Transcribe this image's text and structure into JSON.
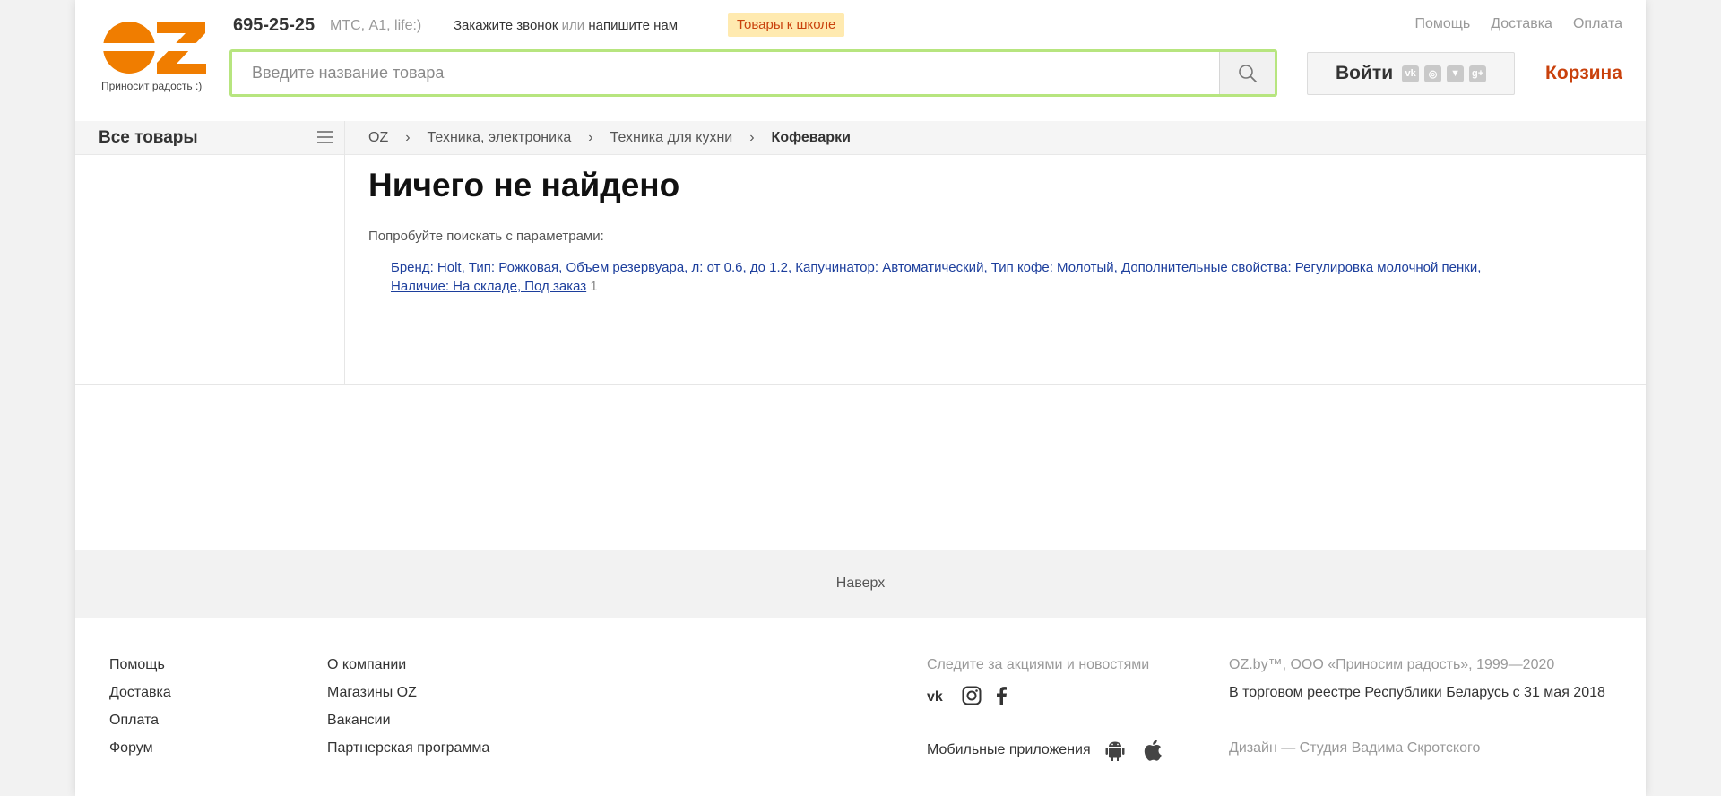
{
  "header": {
    "logo_text": "OZ",
    "logo_slogan": "Приносит радость :)",
    "phone": "695-25-25",
    "operators": "МТС, A1, life:)",
    "callback_order": "Закажите звонок",
    "callback_or": "или",
    "callback_write": "напишите нам",
    "school_badge": "Товары к школе",
    "top_links": [
      "Помощь",
      "Доставка",
      "Оплата"
    ],
    "search_placeholder": "Введите название товара",
    "login_label": "Войти",
    "cart_label": "Корзина"
  },
  "catalog": {
    "all_goods": "Все товары",
    "breadcrumb": [
      "OZ",
      "Техника, электроника",
      "Техника для кухни",
      "Кофеварки"
    ]
  },
  "main": {
    "title": "Ничего не найдено",
    "hint": "Попробуйте поискать с параметрами:",
    "suggestion_line1": "Бренд: Holt, Тип: Рожковая, Объем резервуара, л: от 0.6, до 1.2, Капучинатор: Автоматический, Тип кофе: Молотый, Дополнительные свойства: Регулировка молочной пенки,",
    "suggestion_line2": "Наличие: На складе, Под заказ",
    "suggestion_count": "1"
  },
  "totop": "Наверх",
  "footer": {
    "col1": [
      "Помощь",
      "Доставка",
      "Оплата",
      "Форум"
    ],
    "col2": [
      "О компании",
      "Магазины OZ",
      "Вакансии",
      "Партнерская программа"
    ],
    "follow": "Следите за акциями и новостями",
    "apps": "Мобильные приложения",
    "copyright": "OZ.by™, ООО «Приносим радость», 1999—2020",
    "registry": "В торговом реестре Республики Беларусь с 31 мая 2018",
    "design": "Дизайн — Студия Вадима Скротского"
  },
  "colors": {
    "accent": "#c9410c",
    "logo_orange": "#f07d00",
    "search_border": "#b7e57f",
    "link": "#1c3e9c"
  }
}
